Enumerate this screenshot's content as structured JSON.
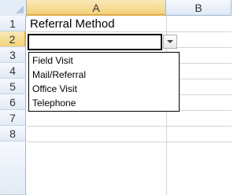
{
  "columns": [
    "A",
    "B"
  ],
  "rows": [
    "1",
    "2",
    "3",
    "4",
    "5",
    "6",
    "7",
    "8"
  ],
  "cells": {
    "A1": "Referral Method"
  },
  "dropdown": {
    "options": [
      "Field Visit",
      "Mail/Referral",
      "Office Visit",
      "Telephone"
    ]
  },
  "colors": {
    "selected_header": "#f2d27a",
    "header": "#e4ecf7",
    "gridline": "#d4d4d4"
  }
}
